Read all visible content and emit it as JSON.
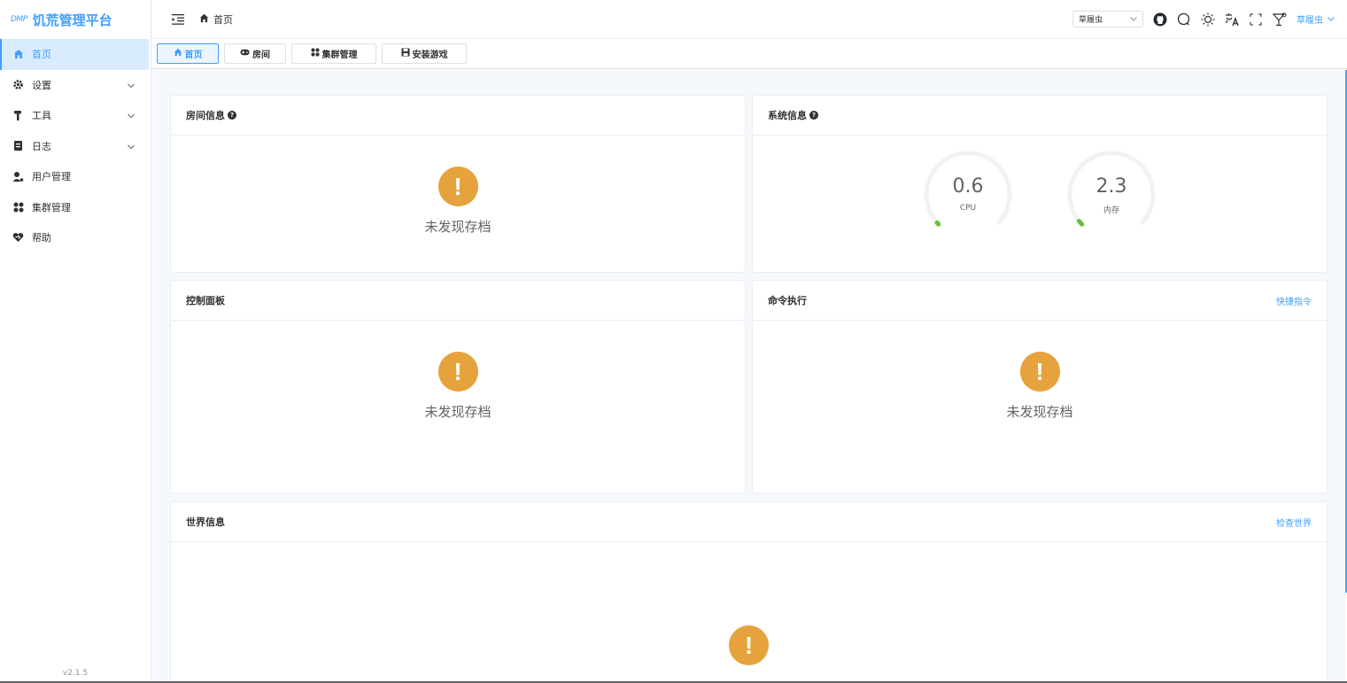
{
  "app": {
    "logo_mark": "DMP",
    "title": "饥荒管理平台",
    "version": "v2.1.5"
  },
  "sidebar": {
    "items": [
      {
        "label": "首页",
        "icon": "home-icon",
        "active": true
      },
      {
        "label": "设置",
        "icon": "gear-icon",
        "expandable": true
      },
      {
        "label": "工具",
        "icon": "hammer-icon",
        "expandable": true
      },
      {
        "label": "日志",
        "icon": "log-icon",
        "expandable": true
      },
      {
        "label": "用户管理",
        "icon": "user-manage-icon"
      },
      {
        "label": "集群管理",
        "icon": "cluster-icon"
      },
      {
        "label": "帮助",
        "icon": "help-heart-icon"
      }
    ]
  },
  "header": {
    "breadcrumb": "首页",
    "cluster_select": "草履虫",
    "user": "草履虫"
  },
  "tabs": [
    {
      "label": "首页",
      "icon": "home-icon",
      "active": true
    },
    {
      "label": "房间",
      "icon": "gamepad-icon"
    },
    {
      "label": "集群管理",
      "icon": "cluster-icon"
    },
    {
      "label": "安装游戏",
      "icon": "save-icon"
    }
  ],
  "cards": {
    "room_info": {
      "title": "房间信息",
      "empty": "未发现存档"
    },
    "system_info": {
      "title": "系统信息",
      "cpu": {
        "value": "0.6",
        "label": "CPU",
        "percent": 0.6
      },
      "memory": {
        "value": "2.3",
        "label": "内存",
        "percent": 2.3
      }
    },
    "control_panel": {
      "title": "控制面板",
      "empty": "未发现存档"
    },
    "command": {
      "title": "命令执行",
      "link": "快捷指令",
      "empty": "未发现存档"
    },
    "world_info": {
      "title": "世界信息",
      "link": "检查世界"
    }
  },
  "colors": {
    "accent": "#409eff",
    "warning": "#e6a23c",
    "gauge_fill": "#67c23a",
    "gauge_track": "#f0f2f5"
  }
}
